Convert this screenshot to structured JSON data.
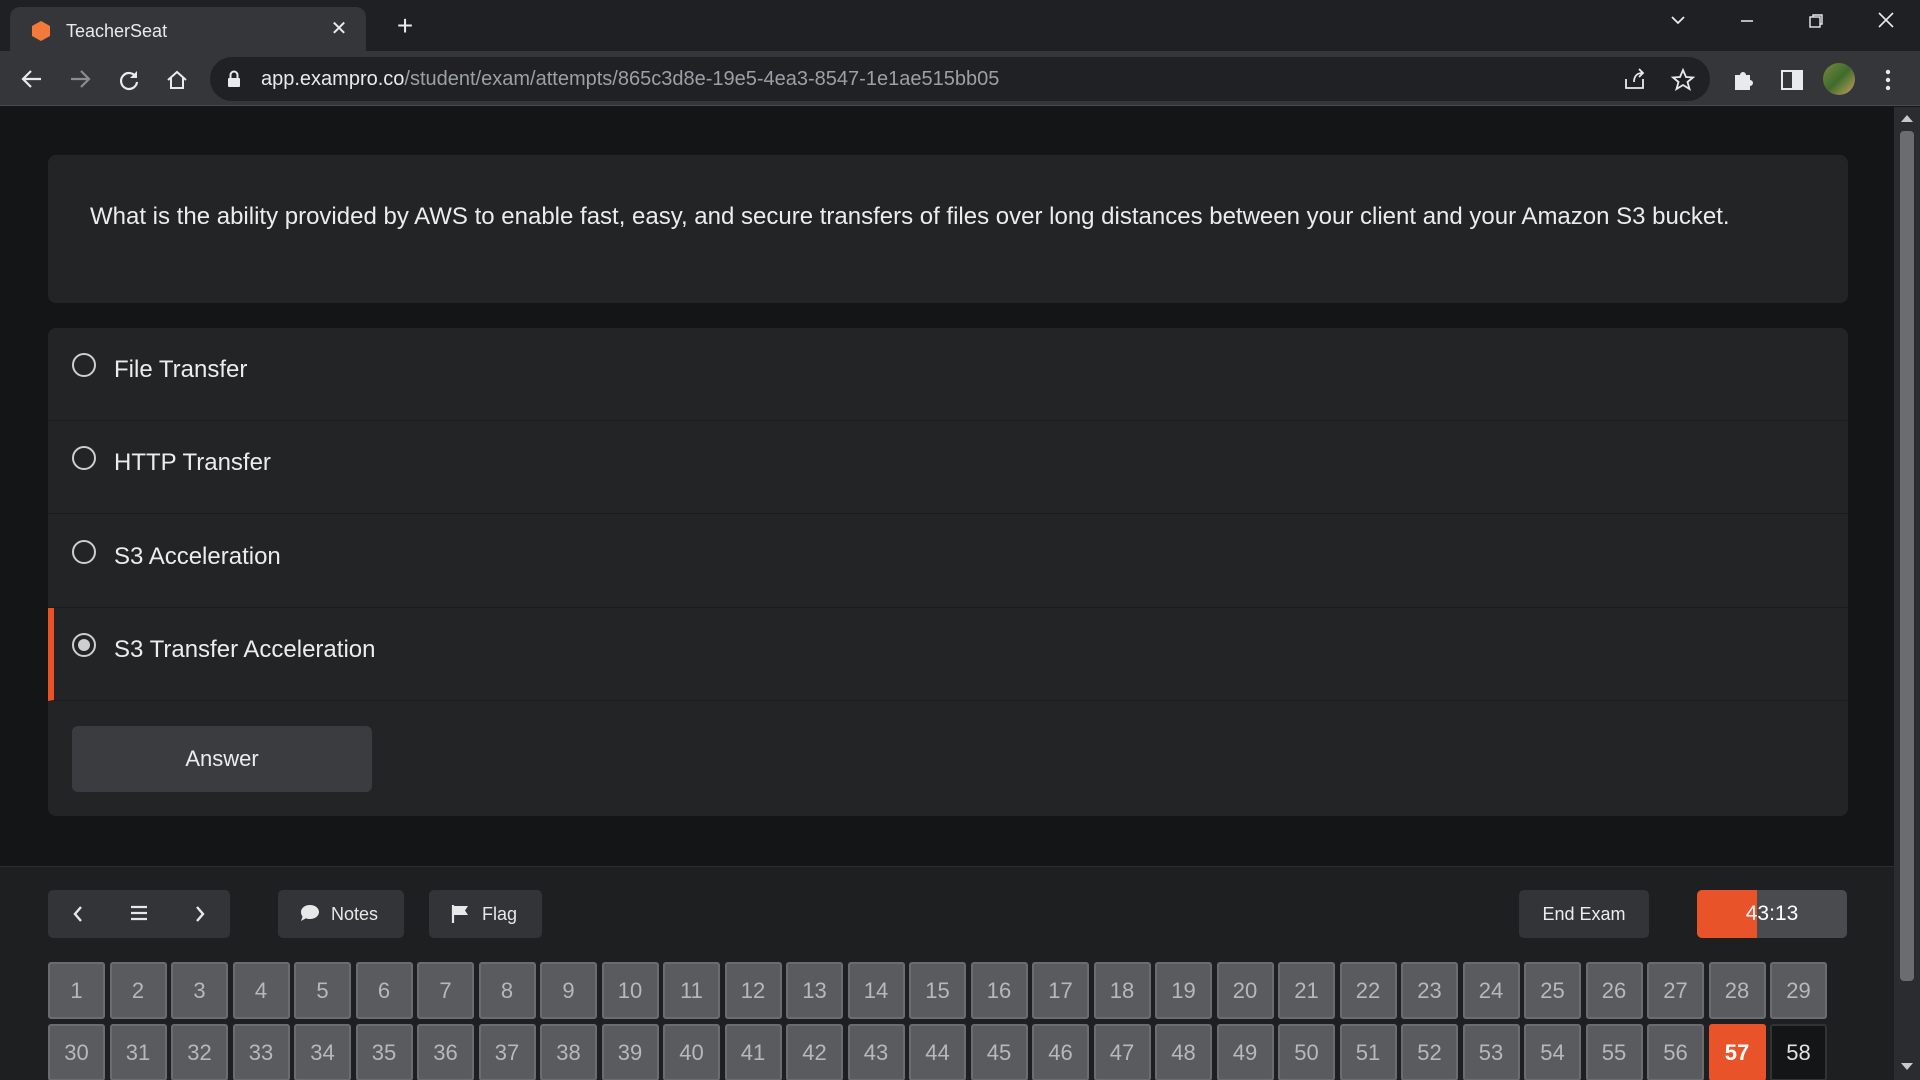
{
  "browser": {
    "tab_title": "TeacherSeat",
    "url_host": "app.exampro.co",
    "url_path": "/student/exam/attempts/865c3d8e-19e5-4ea3-8547-1e1ae515bb05"
  },
  "question": {
    "text": "What is the ability provided by AWS to enable fast, easy, and secure transfers of files over long distances between your client and your Amazon S3 bucket."
  },
  "options": [
    {
      "label": "File Transfer",
      "selected": false
    },
    {
      "label": "HTTP Transfer",
      "selected": false
    },
    {
      "label": "S3 Acceleration",
      "selected": false
    },
    {
      "label": "S3 Transfer Acceleration",
      "selected": true
    }
  ],
  "answer_button": "Answer",
  "toolbar": {
    "notes_label": "Notes",
    "flag_label": "Flag",
    "end_exam_label": "End Exam",
    "timer": "43:13",
    "timer_progress": 0.4
  },
  "question_grid": {
    "row1": [
      "1",
      "2",
      "3",
      "4",
      "5",
      "6",
      "7",
      "8",
      "9",
      "10",
      "11",
      "12",
      "13",
      "14",
      "15",
      "16",
      "17",
      "18",
      "19",
      "20",
      "21",
      "22",
      "23",
      "24",
      "25",
      "26",
      "27",
      "28",
      "29"
    ],
    "row2": [
      "30",
      "31",
      "32",
      "33",
      "34",
      "35",
      "36",
      "37",
      "38",
      "39",
      "40",
      "41",
      "42",
      "43",
      "44",
      "45",
      "46",
      "47",
      "48",
      "49",
      "50",
      "51",
      "52",
      "53",
      "54",
      "55",
      "56",
      "57",
      "58"
    ],
    "current": "57",
    "unseen": [
      "58"
    ]
  },
  "colors": {
    "accent": "#e8532a",
    "card": "#232426",
    "page_bg": "#141517"
  }
}
